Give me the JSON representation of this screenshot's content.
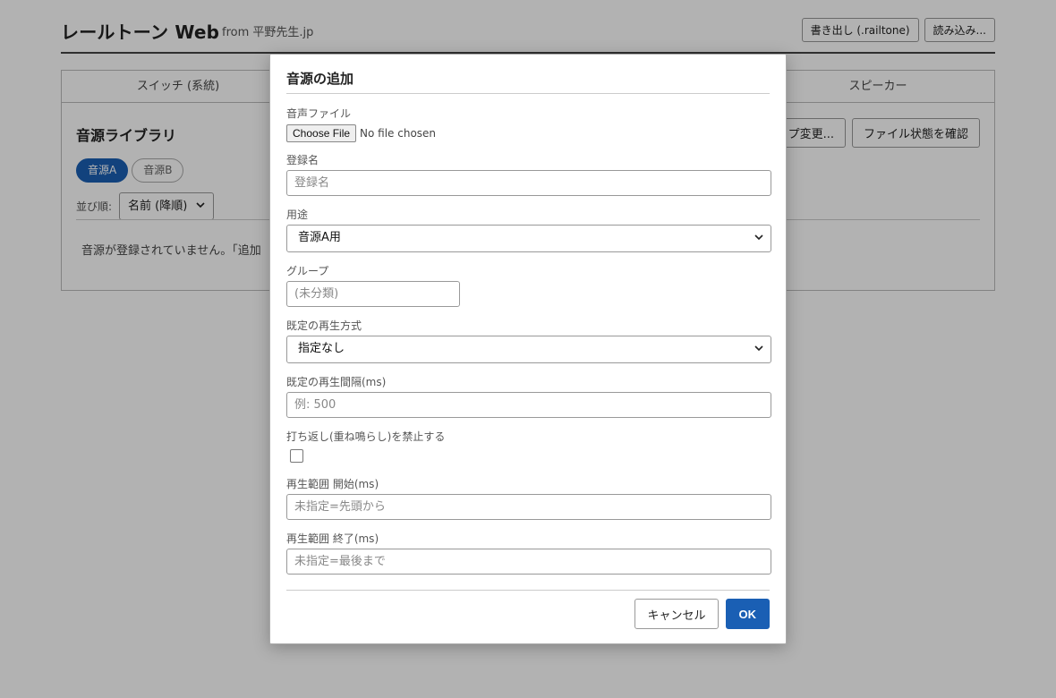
{
  "app": {
    "title": "レールトーン Web",
    "subtitle": "from 平野先生.jp",
    "export_button": "書き出し (.railtone)",
    "import_button": "読み込み...",
    "tabs": {
      "switch": "スイッチ (系統)",
      "speaker": "スピーカー"
    },
    "panel": {
      "title": "音源ライブラリ",
      "pills": [
        "音源A",
        "音源B"
      ],
      "sort_label": "並び順:",
      "sort_value": "名前 (降順)",
      "change_button": "プ変更...",
      "check_button": "ファイル状態を確認",
      "empty_message": "音源が登録されていません。「追加"
    }
  },
  "modal": {
    "title": "音源の追加",
    "file_label": "音声ファイル",
    "file_button": "Choose File",
    "file_status": "No file chosen",
    "name_label": "登録名",
    "name_placeholder": "登録名",
    "usage_label": "用途",
    "usage_value": "音源A用",
    "group_label": "グループ",
    "group_placeholder": "(未分類)",
    "playmode_label": "既定の再生方式",
    "playmode_value": "指定なし",
    "interval_label": "既定の再生間隔(ms)",
    "interval_placeholder": "例: 500",
    "nooverlap_label": "打ち返し(重ね鳴らし)を禁止する",
    "start_label": "再生範囲 開始(ms)",
    "start_placeholder": "未指定=先頭から",
    "end_label": "再生範囲 終了(ms)",
    "end_placeholder": "未指定=最後まで",
    "cancel_button": "キャンセル",
    "ok_button": "OK"
  },
  "colors": {
    "accent": "#1a5fb4"
  },
  "icons": {
    "select_caret": "chevron-down-icon"
  }
}
